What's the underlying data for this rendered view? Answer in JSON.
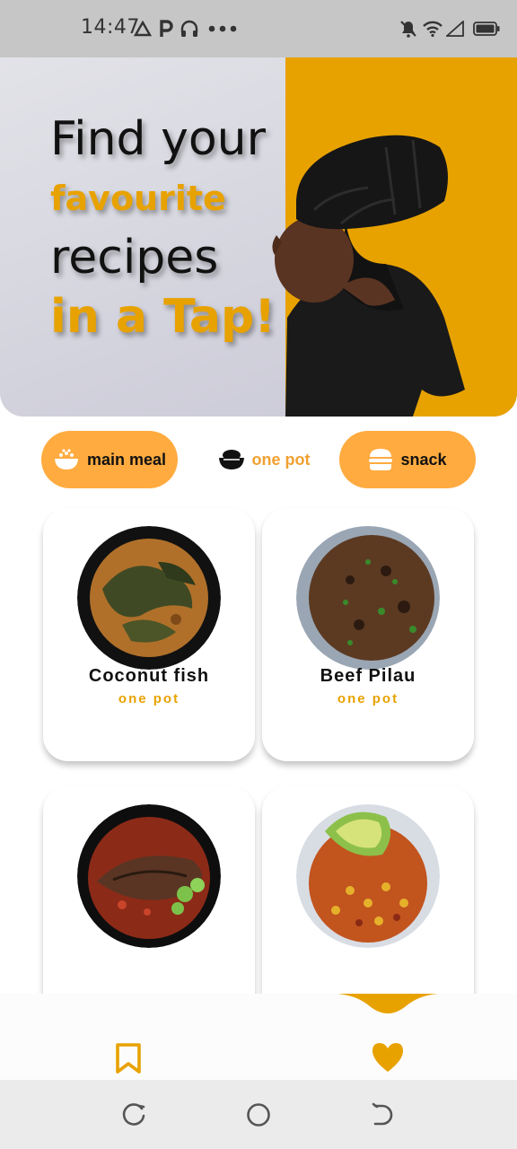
{
  "status_bar": {
    "time": "14:47",
    "icons": [
      "drive-icon",
      "parking-icon",
      "headphones-icon",
      "more-dots-icon",
      "silent-icon",
      "wifi-icon",
      "signal-icon",
      "battery-icon"
    ]
  },
  "hero": {
    "line1": "Find your",
    "line2": "favourite",
    "line3": "recipes",
    "line4": "in a Tap!",
    "colors": {
      "gold": "#e8a200",
      "dark": "#111111",
      "panel": "#e8a200"
    }
  },
  "categories": [
    {
      "label": "main meal",
      "icon": "rice-bowl-icon",
      "active": true
    },
    {
      "label": "one pot",
      "icon": "pot-icon",
      "active": false
    },
    {
      "label": "snack",
      "icon": "burger-icon",
      "active": true
    }
  ],
  "recipes": [
    {
      "name": "Coconut fish",
      "category": "one pot",
      "image": "coconut-fish-image"
    },
    {
      "name": "Beef Pilau",
      "category": "one pot",
      "image": "beef-pilau-image"
    },
    {
      "name": "",
      "category": "",
      "image": "fried-fish-image"
    },
    {
      "name": "",
      "category": "",
      "image": "beans-avocado-image"
    }
  ],
  "bottom_nav": {
    "items": [
      {
        "icon": "bookmark-icon"
      },
      {
        "icon": "blank"
      },
      {
        "icon": "blank"
      },
      {
        "icon": "heart-icon"
      }
    ],
    "accent": "#e8a200"
  },
  "android_nav": [
    "recent-apps-icon",
    "home-icon",
    "back-icon"
  ]
}
